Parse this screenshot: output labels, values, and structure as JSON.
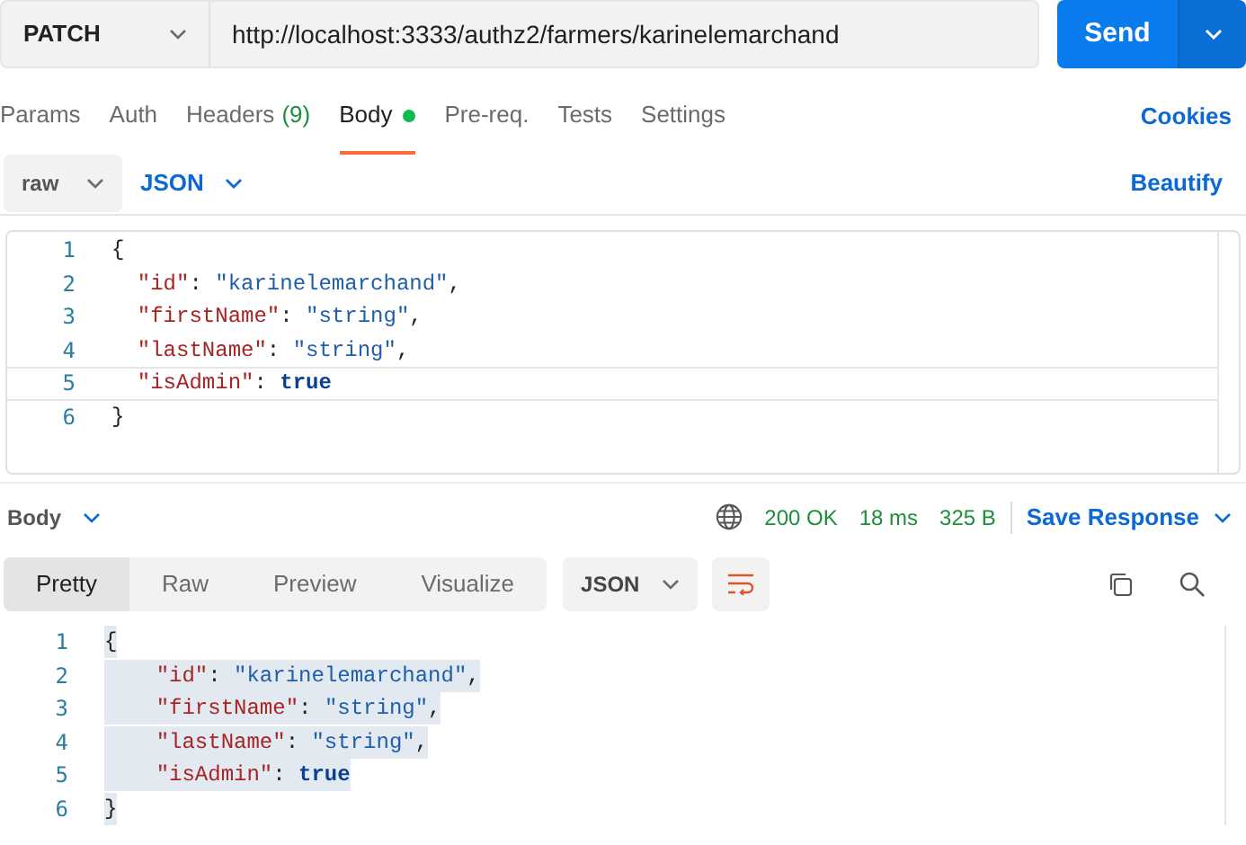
{
  "request": {
    "method": "PATCH",
    "url": "http://localhost:3333/authz2/farmers/karinelemarchand",
    "send_label": "Send"
  },
  "tabs": [
    {
      "label": "Params",
      "selected": false
    },
    {
      "label": "Auth",
      "selected": false
    },
    {
      "label": "Headers",
      "count": "(9)",
      "selected": false
    },
    {
      "label": "Body",
      "selected": true,
      "dot": true
    },
    {
      "label": "Pre-req.",
      "selected": false
    },
    {
      "label": "Tests",
      "selected": false
    },
    {
      "label": "Settings",
      "selected": false
    }
  ],
  "cookies_link": "Cookies",
  "body_options": {
    "mode": "raw",
    "language": "JSON",
    "beautify": "Beautify"
  },
  "request_body": {
    "lines": [
      {
        "number": "1",
        "text": "{"
      },
      {
        "number": "2",
        "text": "  \"id\": \"karinelemarchand\","
      },
      {
        "number": "3",
        "text": "  \"firstName\": \"string\","
      },
      {
        "number": "4",
        "text": "  \"lastName\": \"string\","
      },
      {
        "number": "5",
        "text": "  \"isAdmin\": true",
        "selected": true
      },
      {
        "number": "6",
        "text": "}"
      }
    ]
  },
  "response_header": {
    "label": "Body",
    "status": "200 OK",
    "time": "18 ms",
    "size": "325 B",
    "save": "Save Response"
  },
  "response_tabs": [
    {
      "label": "Pretty",
      "selected": true
    },
    {
      "label": "Raw",
      "selected": false
    },
    {
      "label": "Preview",
      "selected": false
    },
    {
      "label": "Visualize",
      "selected": false
    }
  ],
  "response_format": "JSON",
  "response_body": {
    "lines": [
      {
        "number": "1",
        "text": "{"
      },
      {
        "number": "2",
        "text": "    \"id\": \"karinelemarchand\","
      },
      {
        "number": "3",
        "text": "    \"firstName\": \"string\","
      },
      {
        "number": "4",
        "text": "    \"lastName\": \"string\","
      },
      {
        "number": "5",
        "text": "    \"isAdmin\": true"
      },
      {
        "number": "6",
        "text": "}"
      }
    ]
  }
}
